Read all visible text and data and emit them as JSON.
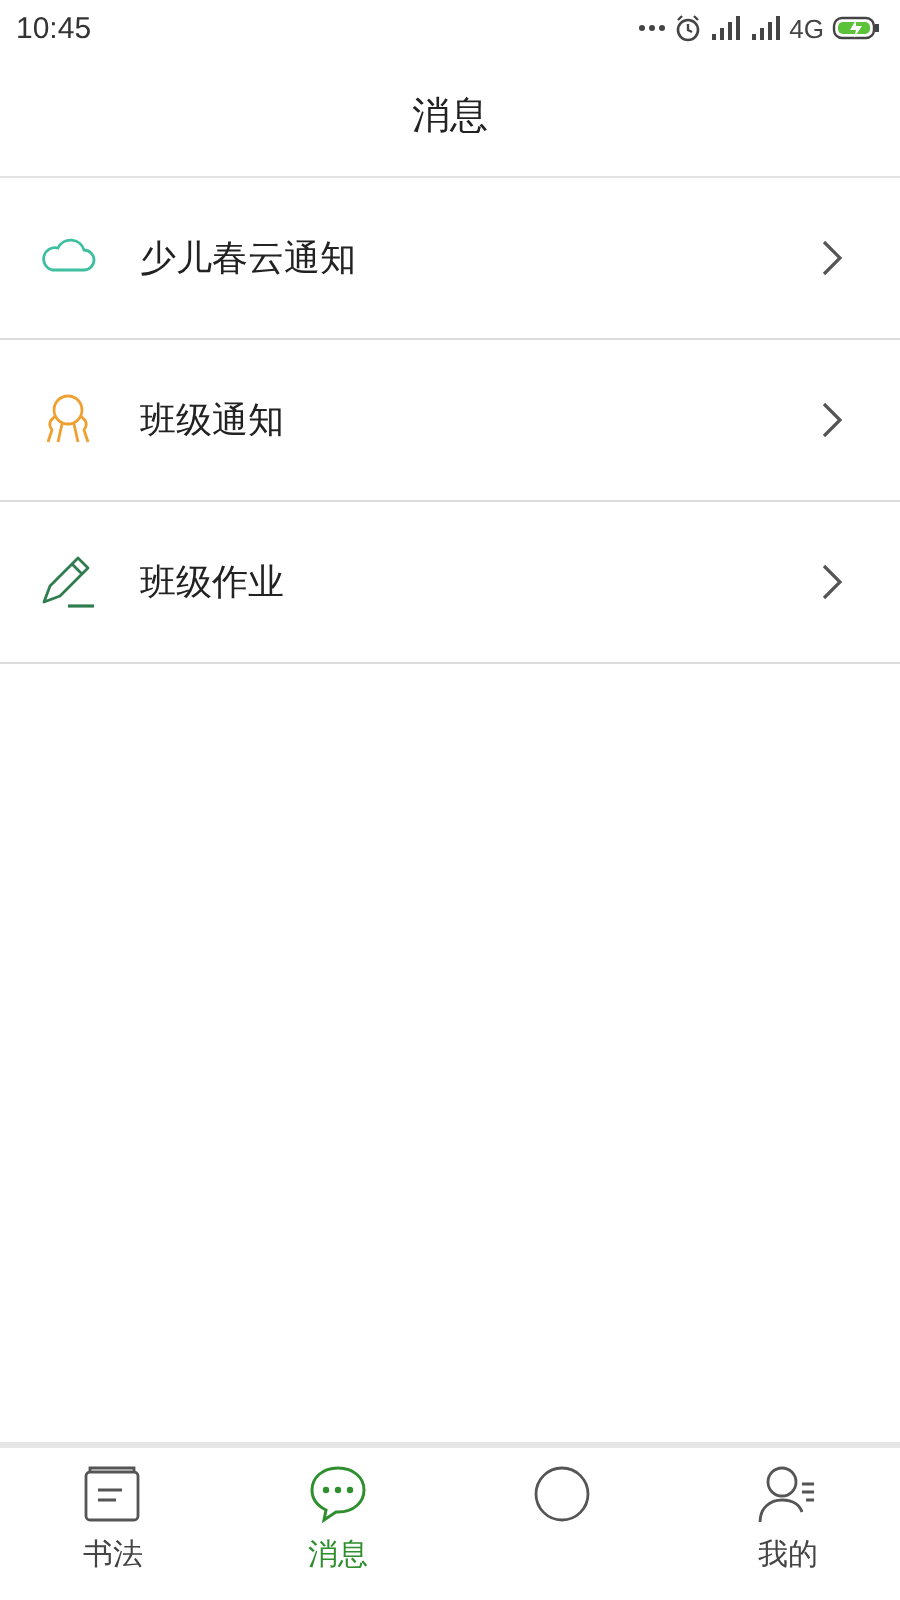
{
  "status_bar": {
    "time": "10:45",
    "network": "4G"
  },
  "header": {
    "title": "消息"
  },
  "items": [
    {
      "label": "少儿春云通知",
      "kind": "cloud",
      "color": "#3dbfa0"
    },
    {
      "label": "班级通知",
      "kind": "people",
      "color": "#f0a030"
    },
    {
      "label": "班级作业",
      "kind": "pencil",
      "color": "#2e7d4f"
    }
  ],
  "tabs": [
    {
      "label": "书法",
      "kind": "book",
      "selected": false
    },
    {
      "label": "消息",
      "kind": "chat",
      "selected": true
    },
    {
      "kind": "circle",
      "selected": false
    },
    {
      "label": "我的",
      "kind": "user",
      "selected": false
    }
  ]
}
